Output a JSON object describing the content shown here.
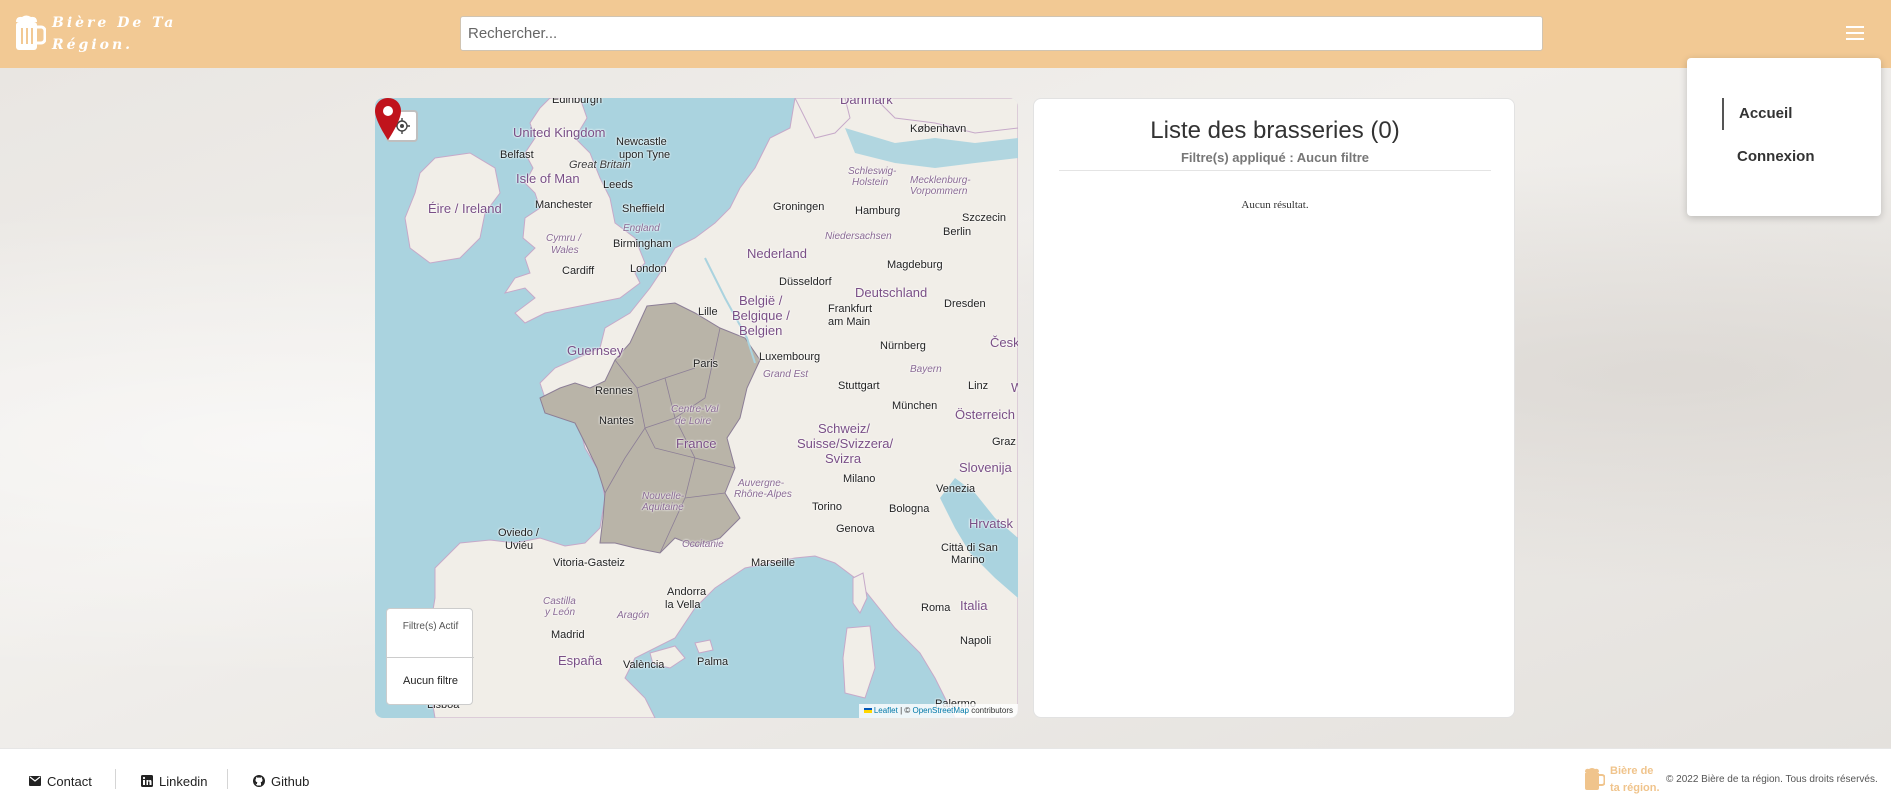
{
  "header": {
    "brand": "Bière De Ta Région.",
    "search_placeholder": "Rechercher..."
  },
  "nav_menu": {
    "items": [
      {
        "label": "Accueil",
        "active": true
      },
      {
        "label": "Connexion",
        "active": false
      }
    ]
  },
  "map": {
    "filter_box": {
      "title": "Filtre(s) Actif",
      "value": "Aucun filtre"
    },
    "attribution": {
      "leaflet": "Leaflet",
      "separator": " | © ",
      "osm": "OpenStreetMap",
      "suffix": " contributors"
    },
    "labels": {
      "edinburgh": "Edinburgh",
      "danmark": "Danmark",
      "kobenhavn": "København",
      "united_kingdom": "United Kingdom",
      "newcastle": "Newcastle",
      "upon_tyne": "upon Tyne",
      "belfast": "Belfast",
      "great_britain": "Great Britain",
      "isle_of_man": "Isle of Man",
      "schleswig": "Schleswig-",
      "holstein": "Holstein",
      "mecklenburg": "Mecklenburg-",
      "vorpommern": "Vorpommern",
      "leeds": "Leeds",
      "manchester": "Manchester",
      "sheffield": "Sheffield",
      "eire": "Éire / Ireland",
      "england": "England",
      "groningen": "Groningen",
      "hamburg": "Hamburg",
      "szczecin": "Szczecin",
      "cymru": "Cymru /",
      "wales": "Wales",
      "birmingham": "Birmingham",
      "niedersachsen": "Niedersachsen",
      "berlin": "Berlin",
      "nederland": "Nederland",
      "magdeburg": "Magdeburg",
      "cardiff": "Cardiff",
      "london": "London",
      "dusseldorf": "Düsseldorf",
      "deutschland": "Deutschland",
      "belgie": "België /",
      "belgique": "Belgique /",
      "belgien": "Belgien",
      "lille": "Lille",
      "frankfurt": "Frankfurt",
      "am_main": "am Main",
      "dresden": "Dresden",
      "guernsey": "Guernsey",
      "cesk": "Česk",
      "paris": "Paris",
      "luxembourg": "Luxembourg",
      "nurnberg": "Nürnberg",
      "grand_est": "Grand Est",
      "bayern": "Bayern",
      "rennes": "Rennes",
      "stuttgart": "Stuttgart",
      "linz": "Linz",
      "w": "W",
      "centre_val": "Centre-Val",
      "de_loire": "de Loire",
      "munchen": "München",
      "osterreich": "Österreich",
      "nantes": "Nantes",
      "schweiz": "Schweiz/",
      "suisse": "Suisse/Svizzera/",
      "svizra": "Svizra",
      "france": "France",
      "graz": "Graz",
      "slovenija": "Slovenija",
      "auvergne": "Auvergne-",
      "rhone_alpes": "Rhône-Alpes",
      "milano": "Milano",
      "venezia": "Venezia",
      "nouvelle": "Nouvelle-",
      "aquitaine": "Aquitaine",
      "torino": "Torino",
      "bologna": "Bologna",
      "hrvatsk": "Hrvatsk",
      "oviedo": "Oviedo /",
      "uvieu": "Uviéu",
      "genova": "Genova",
      "occitanie": "Occitanie",
      "citta": "Città di San",
      "marino": "Marino",
      "vitoria": "Vitoria-Gasteiz",
      "marseille": "Marseille",
      "andorra": "Andorra",
      "la_vella": "la Vella",
      "castilla": "Castilla",
      "y_leon": "y León",
      "aragon": "Aragón",
      "italia": "Italia",
      "roma": "Roma",
      "madrid": "Madrid",
      "napoli": "Napoli",
      "espana": "España",
      "valencia": "València",
      "palma": "Palma",
      "lisboa": "Lisboa",
      "palermo": "Palermo"
    }
  },
  "list_panel": {
    "title": "Liste des brasseries (0)",
    "subtitle": "Filtre(s) appliqué : Aucun filtre",
    "empty": "Aucun résultat."
  },
  "footer": {
    "contact": "Contact",
    "linkedin": "Linkedin",
    "github": "Github",
    "brand_line1": "Bière de",
    "brand_line2": "ta région.",
    "copyright": "© 2022 Bière de ta région. Tous droits réservés."
  },
  "colors": {
    "header_bg": "#f2c994",
    "brand_accent": "#f0c48c",
    "pin": "#c0131c",
    "water": "#aad3df",
    "land": "#f1eee8"
  }
}
